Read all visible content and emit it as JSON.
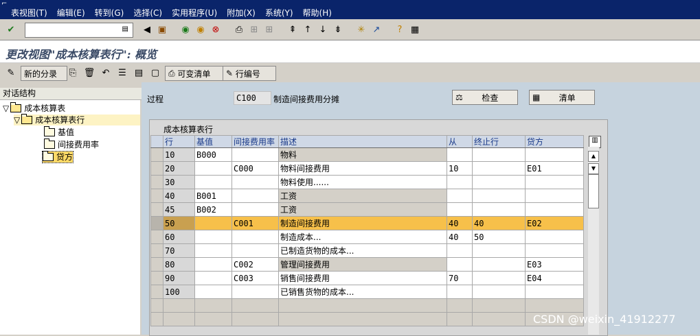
{
  "menu": [
    "表视图(T)",
    "编辑(E)",
    "转到(G)",
    "选择(C)",
    "实用程序(U)",
    "附加(X)",
    "系统(Y)",
    "帮助(H)"
  ],
  "command_field": {
    "value": "",
    "placeholder": ""
  },
  "page_title": "更改视图\"成本核算表行\": 概览",
  "toolbar2": {
    "new_entries": "新的分录",
    "variable_list": "可变清单",
    "row_number": "行编号"
  },
  "tree": {
    "header": "对话结构",
    "nodes": [
      "成本核算表",
      "成本核算表行",
      "基值",
      "间接费用率",
      "贷方"
    ]
  },
  "process": {
    "label": "过程",
    "value": "C100",
    "description": "制造间接费用分摊"
  },
  "buttons": {
    "check": "检查",
    "list": "清单"
  },
  "table": {
    "title": "成本核算表行",
    "columns": [
      "行",
      "基值",
      "间接费用率",
      "描述",
      "从",
      "终止行",
      "贷方"
    ],
    "rows": [
      {
        "row": "10",
        "base": "B000",
        "ovh": "",
        "desc": "物料",
        "from": "",
        "to": "",
        "credit": ""
      },
      {
        "row": "20",
        "base": "",
        "ovh": "C000",
        "desc": "物料间接费用",
        "from": "10",
        "to": "",
        "credit": "E01"
      },
      {
        "row": "30",
        "base": "",
        "ovh": "",
        "desc": "物料使用......",
        "from": "",
        "to": "",
        "credit": ""
      },
      {
        "row": "40",
        "base": "B001",
        "ovh": "",
        "desc": "工资",
        "from": "",
        "to": "",
        "credit": ""
      },
      {
        "row": "45",
        "base": "B002",
        "ovh": "",
        "desc": "工资",
        "from": "",
        "to": "",
        "credit": ""
      },
      {
        "row": "50",
        "base": "",
        "ovh": "C001",
        "desc": "制造间接费用",
        "from": "40",
        "to": "40",
        "credit": "E02"
      },
      {
        "row": "60",
        "base": "",
        "ovh": "",
        "desc": "制造成本...",
        "from": "40",
        "to": "50",
        "credit": ""
      },
      {
        "row": "70",
        "base": "",
        "ovh": "",
        "desc": "已制造货物的成本...",
        "from": "",
        "to": "",
        "credit": ""
      },
      {
        "row": "80",
        "base": "",
        "ovh": "C002",
        "desc": "管理间接费用",
        "from": "",
        "to": "",
        "credit": "E03"
      },
      {
        "row": "90",
        "base": "",
        "ovh": "C003",
        "desc": "销售间接费用",
        "from": "70",
        "to": "",
        "credit": "E04"
      },
      {
        "row": "100",
        "base": "",
        "ovh": "",
        "desc": "已销售货物的成本...",
        "from": "",
        "to": "",
        "credit": ""
      }
    ]
  },
  "watermark": "CSDN @weixin_41912277",
  "colors": {
    "menubar": "#0a246a",
    "selected_row": "#f7c04a",
    "panel_bg": "#c6d3de",
    "title_text": "#3a4a66"
  }
}
